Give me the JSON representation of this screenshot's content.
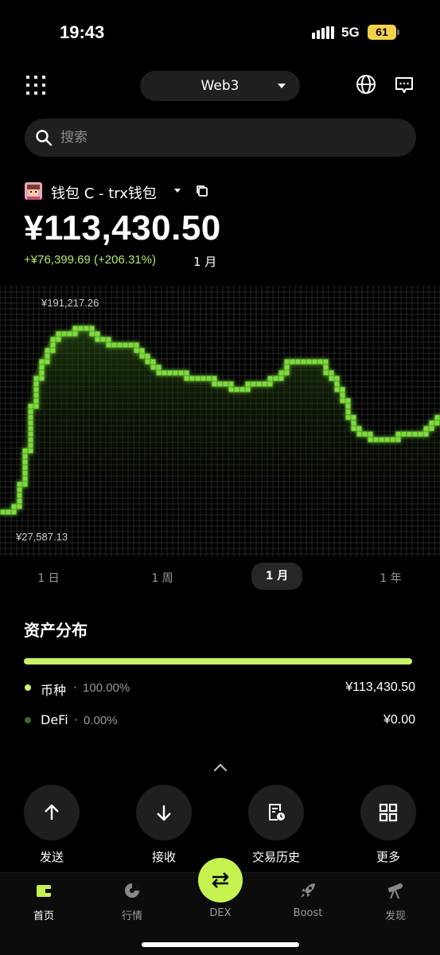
{
  "status_bar": {
    "time": "19:43",
    "network": "5G",
    "battery": "61"
  },
  "header": {
    "mode_label": "Web3"
  },
  "search": {
    "placeholder": "搜索"
  },
  "wallet": {
    "name": "钱包 C - trx钱包",
    "balance": "¥113,430.50",
    "change": "+¥76,399.69 (+206.31%)",
    "change_period": "1 月"
  },
  "chart_data": {
    "type": "line",
    "max_label": "¥191,217.26",
    "min_label": "¥27,587.13",
    "accent": "#7cdc3a",
    "values": [
      30000,
      27587,
      60000,
      130000,
      160000,
      178000,
      185000,
      187000,
      191217,
      188000,
      182000,
      178000,
      175000,
      176000,
      170000,
      160000,
      152000,
      150000,
      150000,
      149000,
      148000,
      146000,
      144000,
      140000,
      138000,
      138000,
      140000,
      141000,
      145000,
      152000,
      165000,
      158000,
      162000,
      162000,
      150000,
      135000,
      115000,
      100000,
      95000,
      92000,
      93000,
      95000,
      96000,
      97000,
      98000,
      112000,
      113430
    ]
  },
  "period_tabs": [
    {
      "label": "1 日",
      "active": false
    },
    {
      "label": "1 周",
      "active": false
    },
    {
      "label": "1 月",
      "active": true
    },
    {
      "label": "1 年",
      "active": false
    }
  ],
  "assets": {
    "title": "资产分布",
    "bar_color": "#c9f26b",
    "items": [
      {
        "label": "币种",
        "pct": "100.00%",
        "value": "¥113,430.50",
        "color": "#c9f26b"
      },
      {
        "label": "DeFi",
        "pct": "0.00%",
        "value": "¥0.00",
        "color": "#3f6a1f"
      }
    ]
  },
  "actions": [
    {
      "label": "发送",
      "icon": "arrow-up-icon"
    },
    {
      "label": "接收",
      "icon": "arrow-down-icon"
    },
    {
      "label": "交易历史",
      "icon": "history-icon"
    },
    {
      "label": "更多",
      "icon": "grid-icon"
    }
  ],
  "bottom_nav": [
    {
      "label": "首页",
      "icon": "wallet-icon",
      "active": true
    },
    {
      "label": "行情",
      "icon": "market-icon",
      "active": false
    },
    {
      "label": "DEX",
      "icon": "swap-icon",
      "active": false
    },
    {
      "label": "Boost",
      "icon": "rocket-icon",
      "active": false
    },
    {
      "label": "发现",
      "icon": "telescope-icon",
      "active": false
    }
  ]
}
